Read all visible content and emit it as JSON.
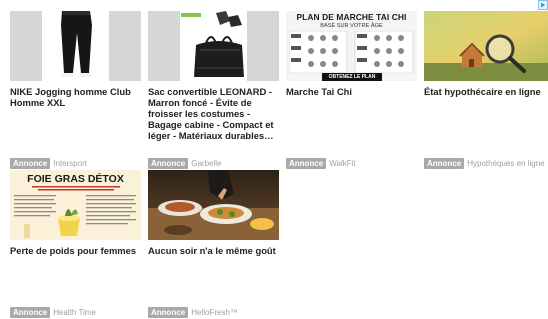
{
  "ad_badge_label": "Annonce",
  "cards": [
    {
      "title": "NIKE Jogging homme Club Homme XXL",
      "brand": "Intersport",
      "thumb_icon": "black-jogging-pants-image"
    },
    {
      "title": "Sac convertible LEONARD - Marron foncé - Évite de froisser les costumes - Bagage cabine - Compact et léger - Matériaux durables…",
      "brand": "Garbelle",
      "thumb_icon": "black-duffel-bag-image"
    },
    {
      "title": "Marche Tai Chi",
      "brand": "WalkFit",
      "thumb_icon": "walking-plan-poster-image",
      "thumb_heading": "PLAN DE MARCHE TAI CHI",
      "thumb_subheading": "BASÉ SUR VOTRE ÂGE",
      "thumb_button": "OBTENEZ LE PLAN"
    },
    {
      "title": "État hypothécaire en ligne",
      "brand": "Hypothèques en ligne",
      "thumb_icon": "magnifier-house-image"
    },
    {
      "title": "Perte de poids pour femmes",
      "brand": "Health Time",
      "thumb_icon": "detox-article-image",
      "thumb_heading": "FOIE GRAS DÉTOX"
    },
    {
      "title": "Aucun soir n'a le même goût",
      "brand": "HelloFresh™",
      "thumb_icon": "dinner-table-image"
    }
  ],
  "colors": {
    "badge": "#a9a9a9",
    "title": "#222222",
    "brand": "#a0a0a0",
    "adchoice": "#7cc4e6"
  }
}
